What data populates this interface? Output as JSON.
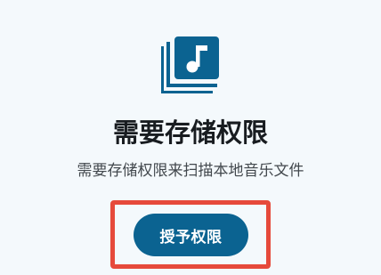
{
  "permission_prompt": {
    "title": "需要存储权限",
    "description": "需要存储权限来扫描本地音乐文件",
    "grant_button_label": "授予权限",
    "icon": "music-library-icon",
    "accent_color": "#0b6391",
    "highlight_color": "#e64a3b"
  }
}
